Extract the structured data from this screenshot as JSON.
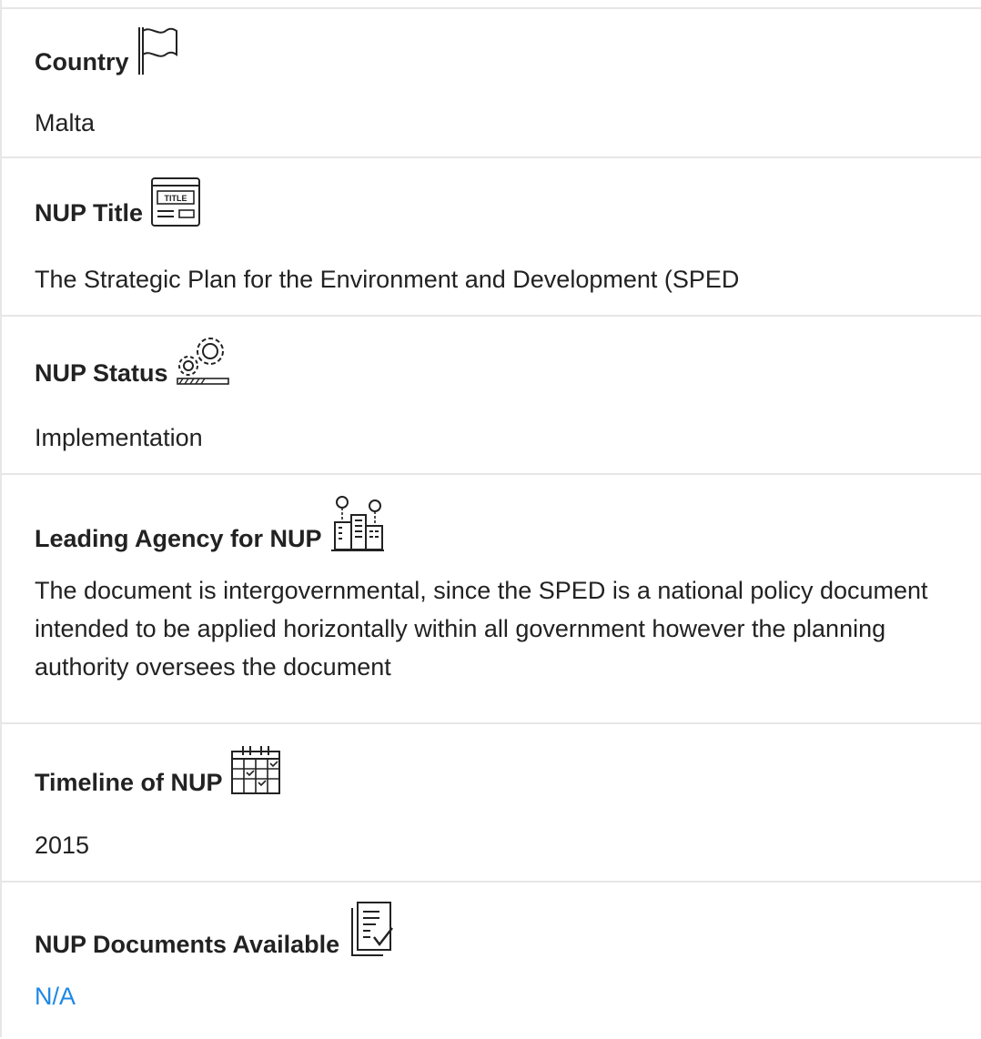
{
  "fields": [
    {
      "label": "Country",
      "icon": "flag-icon",
      "value": "Malta"
    },
    {
      "label": "NUP Title",
      "icon": "title-window-icon",
      "value": "The Strategic Plan for the Environment and Development (SPED"
    },
    {
      "label": "NUP Status",
      "icon": "gears-progress-icon",
      "value": "Implementation"
    },
    {
      "label": "Leading Agency for NUP",
      "icon": "city-buildings-people-icon",
      "value": "The document is intergovernmental, since the SPED is a national policy document intended to be applied horizontally within all government however the planning authority oversees the document"
    },
    {
      "label": "Timeline of NUP",
      "icon": "calendar-icon",
      "value": "2015"
    },
    {
      "label": "NUP Documents Available",
      "icon": "document-check-icon",
      "value": "N/A"
    }
  ],
  "colors": {
    "link": "#1e88e5",
    "divider": "#e6e6e6",
    "text": "#222222"
  }
}
